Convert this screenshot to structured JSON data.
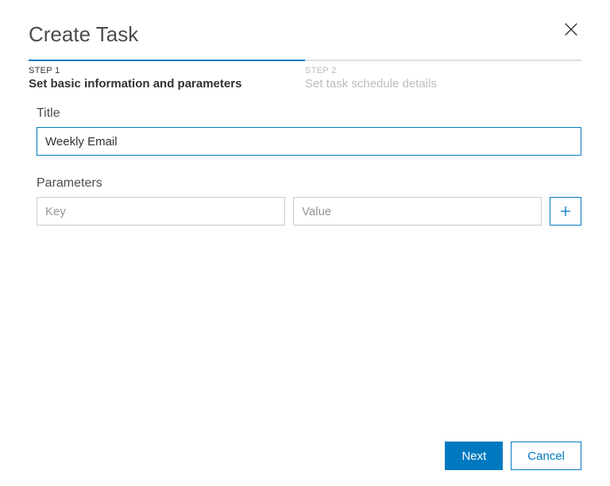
{
  "dialog": {
    "title": "Create Task"
  },
  "stepper": {
    "step1": {
      "label": "STEP 1",
      "desc": "Set basic information and parameters"
    },
    "step2": {
      "label": "STEP 2",
      "desc": "Set task schedule details"
    }
  },
  "form": {
    "title_label": "Title",
    "title_value": "Weekly Email",
    "parameters_label": "Parameters",
    "key_placeholder": "Key",
    "value_placeholder": "Value"
  },
  "footer": {
    "next": "Next",
    "cancel": "Cancel"
  }
}
